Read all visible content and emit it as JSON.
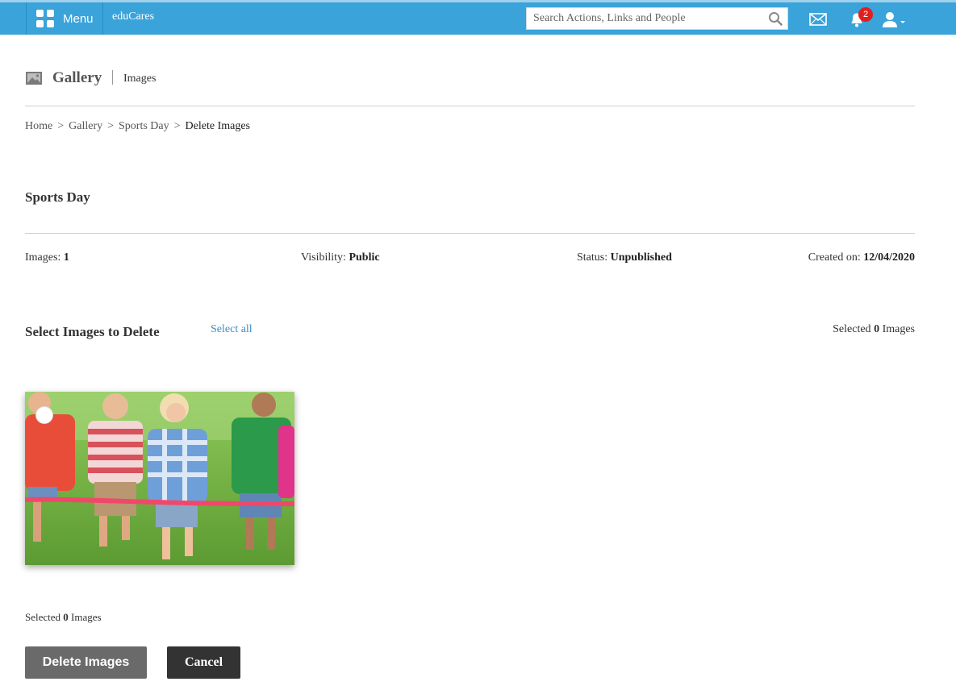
{
  "topbar": {
    "menu_label": "Menu",
    "brand": "eduCares",
    "search_placeholder": "Search Actions, Links and People",
    "notification_count": "2",
    "icons": [
      "grid-icon",
      "search-icon",
      "mail-icon",
      "bell-icon",
      "user-icon"
    ],
    "colors": {
      "bar": "#3aa3d9",
      "badge": "#e02020"
    }
  },
  "header": {
    "title": "Gallery",
    "subtitle": "Images"
  },
  "breadcrumb": {
    "items": [
      "Home",
      "Gallery",
      "Sports Day"
    ],
    "separator": ">",
    "current": "Delete Images"
  },
  "album": {
    "title": "Sports Day",
    "images_label": "Images:",
    "images_value": "1",
    "visibility_label": "Visibility:",
    "visibility_value": "Public",
    "status_label": "Status:",
    "status_value": "Unpublished",
    "created_label": "Created on:",
    "created_value": "12/04/2020"
  },
  "selection": {
    "heading": "Select Images to Delete",
    "select_all": "Select all",
    "selected_prefix": "Selected",
    "selected_count": "0",
    "selected_suffix": "Images"
  },
  "actions": {
    "delete_label": "Delete Images",
    "cancel_label": "Cancel"
  }
}
